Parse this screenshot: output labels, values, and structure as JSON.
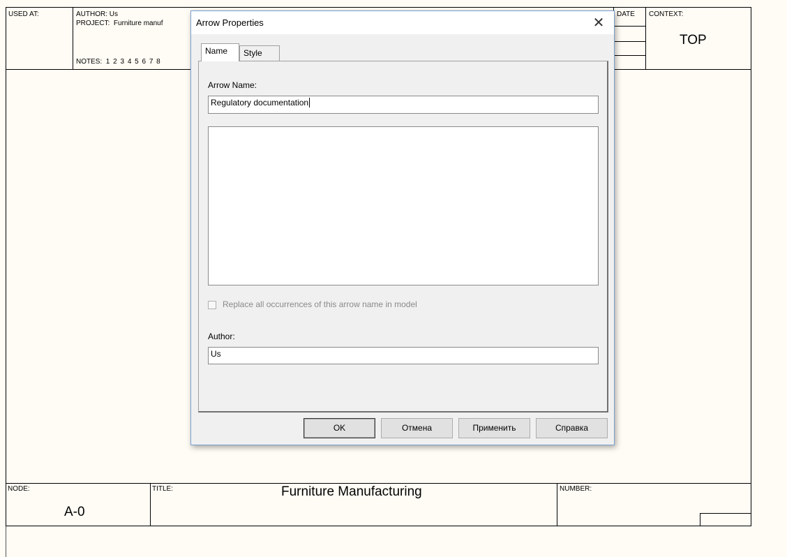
{
  "idef0": {
    "used_at_label": "USED AT:",
    "author_label": "AUTHOR:",
    "author_value": "Us",
    "project_label": "PROJECT:",
    "project_value": "Furniture manuf",
    "notes_label": "NOTES:",
    "notes_numbers": "1 2 3 4 5 6 7 8",
    "date_label": "DATE",
    "context_label": "CONTEXT:",
    "context_value": "TOP",
    "node_label": "NODE:",
    "node_value": "A-0",
    "title_label": "TITLE:",
    "title_value": "Furniture Manufacturing",
    "number_label": "NUMBER:"
  },
  "dialog": {
    "title": "Arrow Properties",
    "close_glyph": "✕",
    "tabs": [
      {
        "label": "Name",
        "active": true
      },
      {
        "label": "Style",
        "active": false
      }
    ],
    "arrow_name_label": "Arrow Name:",
    "arrow_name_value": "Regulatory documentation",
    "description_value": "",
    "replace_checkbox_label": "Replace all occurrences of this arrow name in model",
    "replace_checked": false,
    "author_label": "Author:",
    "author_value": "Us",
    "buttons": {
      "ok": "OK",
      "cancel": "Отмена",
      "apply": "Применить",
      "help": "Справка"
    }
  }
}
